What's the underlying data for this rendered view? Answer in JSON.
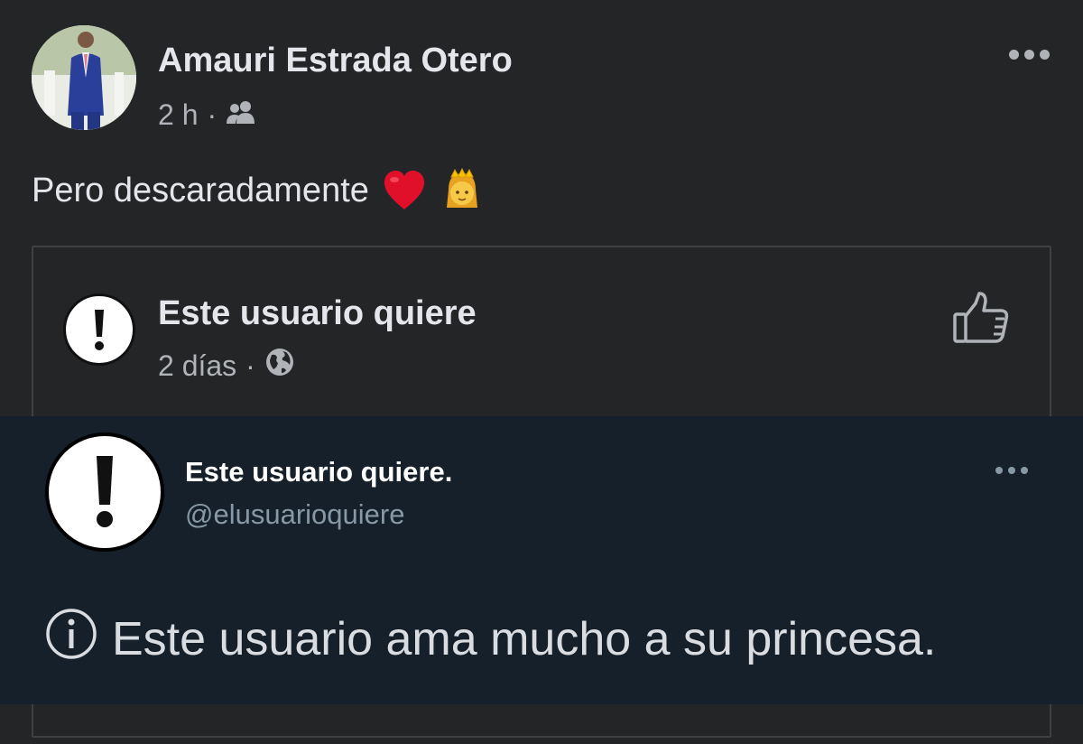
{
  "post": {
    "author_name": "Amauri Estrada Otero",
    "time": "2 h",
    "separator": "·",
    "audience_icon": "friends-icon",
    "text": "Pero descaradamente",
    "emojis": [
      "red-heart",
      "princess"
    ],
    "more_icon": "more-options-icon"
  },
  "shared": {
    "page_name": "Este usuario quiere",
    "time": "2 días",
    "separator": "·",
    "audience_icon": "globe-icon",
    "like_icon": "thumbs-up-icon"
  },
  "tweet": {
    "display_name": "Este usuario quiere.",
    "handle": "@elusuarioquiere",
    "notice": "Este usuario ama mucho a su princesa.",
    "notice_icon": "info-icon",
    "background": "#15202b"
  },
  "colors": {
    "background": "#242526",
    "primary_text": "#e4e6eb",
    "secondary_text": "#b0b3b8"
  }
}
